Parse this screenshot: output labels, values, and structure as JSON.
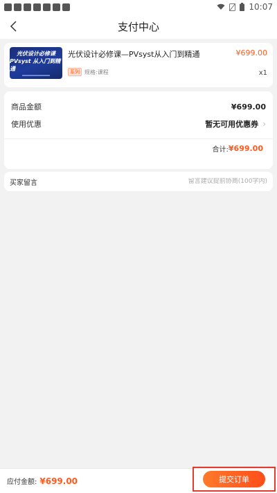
{
  "status_bar": {
    "time": "10:07"
  },
  "header": {
    "title": "支付中心"
  },
  "product": {
    "thumb_line1": "光伏设计必修课",
    "thumb_line2": "PVsyst 从入门到精通",
    "name": "光伏设计必修课—PVsyst从入门到精通",
    "price": "¥699.00",
    "badge": "系列",
    "spec": "规格:课程",
    "qty": "x1"
  },
  "amounts": {
    "goods_label": "商品金额",
    "goods_value": "¥699.00",
    "coupon_label": "使用优惠",
    "coupon_value": "暂无可用优惠券",
    "total_label": "合计:",
    "total_value": "¥699.00"
  },
  "message": {
    "label": "买家留言",
    "placeholder": "留言建议提前协商(100字内)"
  },
  "footer": {
    "payable_label": "应付金额:",
    "payable_value": "¥699.00",
    "submit_label": "提交订单"
  },
  "colors": {
    "accent": "#ff5a1f",
    "highlight_border": "#e23b2c"
  }
}
